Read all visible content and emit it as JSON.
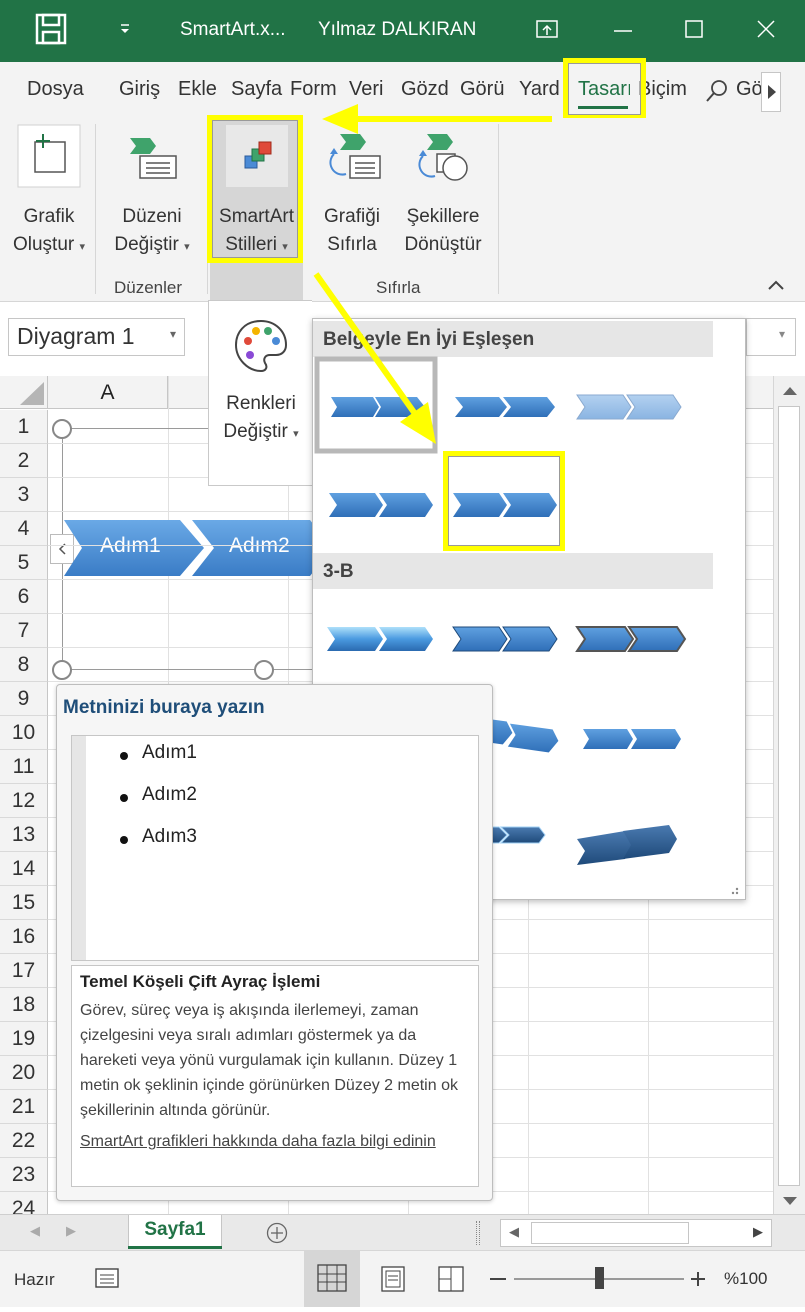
{
  "titlebar": {
    "filename": "SmartArt.x...",
    "user": "Yılmaz DALKIRAN",
    "bg_color": "#217346"
  },
  "tabs": [
    {
      "label": "Dosya"
    },
    {
      "label": "Giriş"
    },
    {
      "label": "Ekle"
    },
    {
      "label": "Sayfa"
    },
    {
      "label": "Form"
    },
    {
      "label": "Veri"
    },
    {
      "label": "Gözd"
    },
    {
      "label": "Görü"
    },
    {
      "label": "Yard"
    },
    {
      "label": "Tasarı"
    },
    {
      "label": "Biçim"
    },
    {
      "label": "Gö"
    }
  ],
  "ribbon": {
    "create_graphic": {
      "line1": "Grafik",
      "line2": "Oluştur"
    },
    "change_layout": {
      "line1": "Düzeni",
      "line2": "Değiştir"
    },
    "smartart_styles": {
      "line1": "SmartArt",
      "line2": "Stilleri"
    },
    "reset_graphic": {
      "line1": "Grafiği",
      "line2": "Sıfırla"
    },
    "convert_shapes": {
      "line1": "Şekillere",
      "line2": "Dönüştür"
    },
    "group_layouts": "Düzenler",
    "group_reset": "Sıfırla"
  },
  "namebox": {
    "value": "Diyagram 1"
  },
  "colors_button": {
    "line1": "Renkleri",
    "line2": "Değiştir"
  },
  "gallery": {
    "section_best_match": "Belgeyle En İyi Eşleşen",
    "section_3d": "3-B"
  },
  "grid": {
    "column_a": "A",
    "rows": [
      "1",
      "2",
      "3",
      "4",
      "5",
      "6",
      "7",
      "8",
      "9",
      "10",
      "11",
      "12",
      "13",
      "14",
      "15",
      "16",
      "17",
      "18",
      "19",
      "20",
      "21",
      "22",
      "23",
      "24"
    ]
  },
  "smartart": {
    "step1": "Adım1",
    "step2": "Adım2"
  },
  "textpane": {
    "title": "Metninizi buraya yazın",
    "bullets": [
      "Adım1",
      "Adım2",
      "Adım3"
    ],
    "info_title": "Temel Köşeli Çift Ayraç İşlemi",
    "info_body": "Görev, süreç veya iş akışında ilerlemeyi, zaman çizelgesini veya sıralı adımları göstermek ya da hareketi veya yönü vurgulamak için kullanın. Düzey 1 metin ok şeklinin içinde görünürken Düzey 2 metin ok şekillerinin altında görünür.",
    "link": "SmartArt grafikleri hakkında daha fazla bilgi edinin"
  },
  "sheet_tab": "Sayfa1",
  "statusbar": {
    "ready": "Hazır",
    "zoom": "%100",
    "zoom_level_percent": 100
  },
  "annotation_color": "#ffff00"
}
